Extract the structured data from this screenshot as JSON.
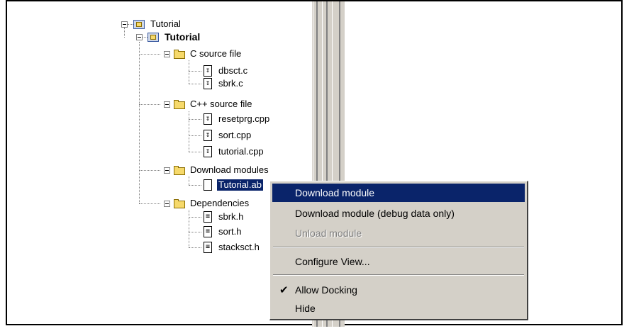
{
  "tree": {
    "root": "Tutorial",
    "project": "Tutorial",
    "groups": [
      {
        "label": "C source file",
        "files": [
          "dbsct.c",
          "sbrk.c"
        ]
      },
      {
        "label": "C++ source file",
        "files": [
          "resetprg.cpp",
          "sort.cpp",
          "tutorial.cpp"
        ]
      },
      {
        "label": "Download modules",
        "files": [
          "Tutorial.ab"
        ]
      },
      {
        "label": "Dependencies",
        "files": [
          "sbrk.h",
          "sort.h",
          "stacksct.h"
        ]
      }
    ]
  },
  "context_menu": {
    "items": [
      {
        "label": "Download module",
        "state": "highlighted"
      },
      {
        "label": "Download module (debug data only)",
        "state": "enabled"
      },
      {
        "label": "Unload module",
        "state": "disabled"
      },
      {
        "label": "Configure View...",
        "state": "enabled"
      },
      {
        "label": "Allow Docking",
        "state": "checked"
      },
      {
        "label": "Hide",
        "state": "enabled"
      }
    ],
    "check_glyph": "✔"
  },
  "icons": {
    "doc_download": "↧",
    "doc_header": "≡"
  },
  "colors": {
    "selection": "#0a246a",
    "menu_bg": "#d4d0c8",
    "disabled_text": "#808080"
  }
}
